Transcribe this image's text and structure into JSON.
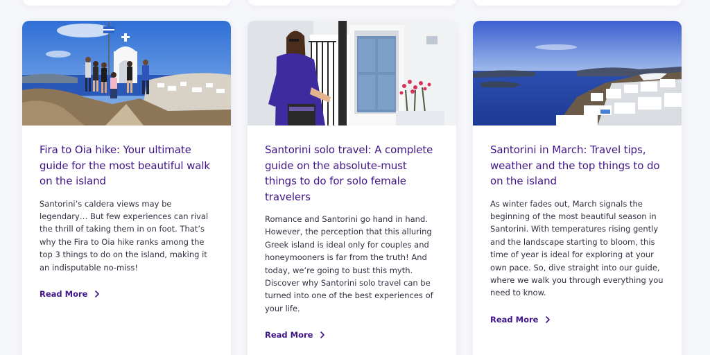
{
  "cards": [
    {
      "title": "Fira to Oia hike: Your ultimate guide for the most beautiful walk on the island",
      "excerpt": "Santorini’s caldera views may be legendary… But few experiences can rival the thrill of taking them in on foot. That’s why the Fira to Oia hike ranks among the top 3 things to do on the island, making it an indisputable no-miss!",
      "read_more": "Read More"
    },
    {
      "title": "Santorini solo travel: A complete guide on the absolute-must things to do for solo female travelers",
      "excerpt": "Romance and Santorini go hand in hand. However, the perception that this alluring Greek island is ideal only for couples and honeymooners is far from the truth! And today, we’re going to bust this myth. Discover why Santorini solo travel can be turned into one of the best experiences of your life.",
      "read_more": "Read More"
    },
    {
      "title": "Santorini in March: Travel tips, weather and the top things to do on the island",
      "excerpt": "As winter fades out, March signals the beginning of the most beautiful season in Santorini. With temperatures rising gently and the landscape starting to bloom, this time of year is ideal for exploring at your own pace. So, dive straight into our guide, where we walk you through everything you need to know.",
      "read_more": "Read More"
    }
  ],
  "colors": {
    "title": "#3f1486",
    "text": "#303040",
    "page_background": "#f6f7fb",
    "card_background": "#ffffff"
  }
}
